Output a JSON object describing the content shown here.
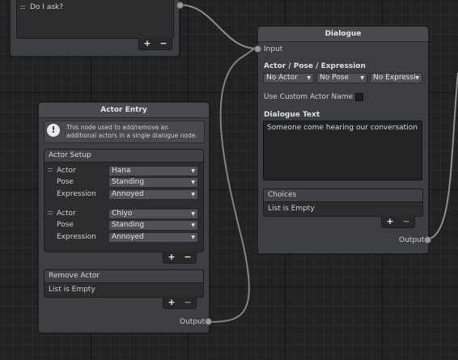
{
  "prev_node": {
    "choice_text": "Do I ask?",
    "add": "+",
    "remove": "−"
  },
  "dialogue": {
    "title": "Dialogue",
    "input_label": "Input",
    "ape_label": "Actor / Pose / Expression",
    "actor_select": "No Actor",
    "pose_select": "No Pose",
    "expression_select": "No Expressi",
    "custom_name_label": "Use Custom Actor Name",
    "custom_name_checked": false,
    "dialogue_text_label": "Dialogue Text",
    "dialogue_text": "Someone come hearing our conversation",
    "choices_label": "Choices",
    "choices_empty": "List is Empty",
    "add": "+",
    "remove": "−",
    "output_label": "Output"
  },
  "actor_entry": {
    "title": "Actor Entry",
    "help_text": "This node used to add/remove an additional actors in a single dialogue node.",
    "setup_label": "Actor Setup",
    "actors": [
      {
        "actor_label": "Actor",
        "actor": "Hana",
        "pose_label": "Pose",
        "pose": "Standing",
        "expression_label": "Expression",
        "expression": "Annoyed"
      },
      {
        "actor_label": "Actor",
        "actor": "Chiyo",
        "pose_label": "Pose",
        "pose": "Standing",
        "expression_label": "Expression",
        "expression": "Annoyed"
      }
    ],
    "add": "+",
    "remove": "−",
    "remove_actor_label": "Remove Actor",
    "remove_actor_empty": "List is Empty",
    "output_label": "Output"
  },
  "colors": {
    "wire": "#8d8d8d",
    "node_bg": "#3d3e41",
    "canvas": "#222222"
  },
  "icons": {
    "help": "exclamation-bubble-icon",
    "dropdown": "caret-down-icon",
    "drag": "drag-handle-icon"
  }
}
